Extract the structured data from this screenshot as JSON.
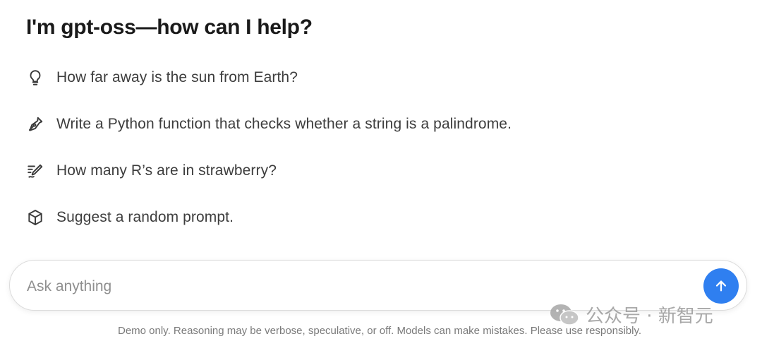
{
  "header": {
    "title": "I'm gpt-oss—how can I help?"
  },
  "suggestions": [
    {
      "icon": "lightbulb-icon",
      "label": "How far away is the sun from Earth?"
    },
    {
      "icon": "pen-nib-icon",
      "label": "Write a Python function that checks whether a string is a palindrome."
    },
    {
      "icon": "pencil-scribble-icon",
      "label": "How many R’s are in strawberry?"
    },
    {
      "icon": "cube-icon",
      "label": "Suggest a random prompt."
    }
  ],
  "composer": {
    "placeholder": "Ask anything",
    "send_icon": "arrow-up-icon",
    "send_color": "#2f7ff0"
  },
  "footer": {
    "disclaimer": "Demo only. Reasoning may be verbose, speculative, or off. Models can make mistakes. Please use responsibly."
  },
  "watermark": {
    "text": "公众号 · 新智元",
    "icon": "wechat-icon"
  }
}
